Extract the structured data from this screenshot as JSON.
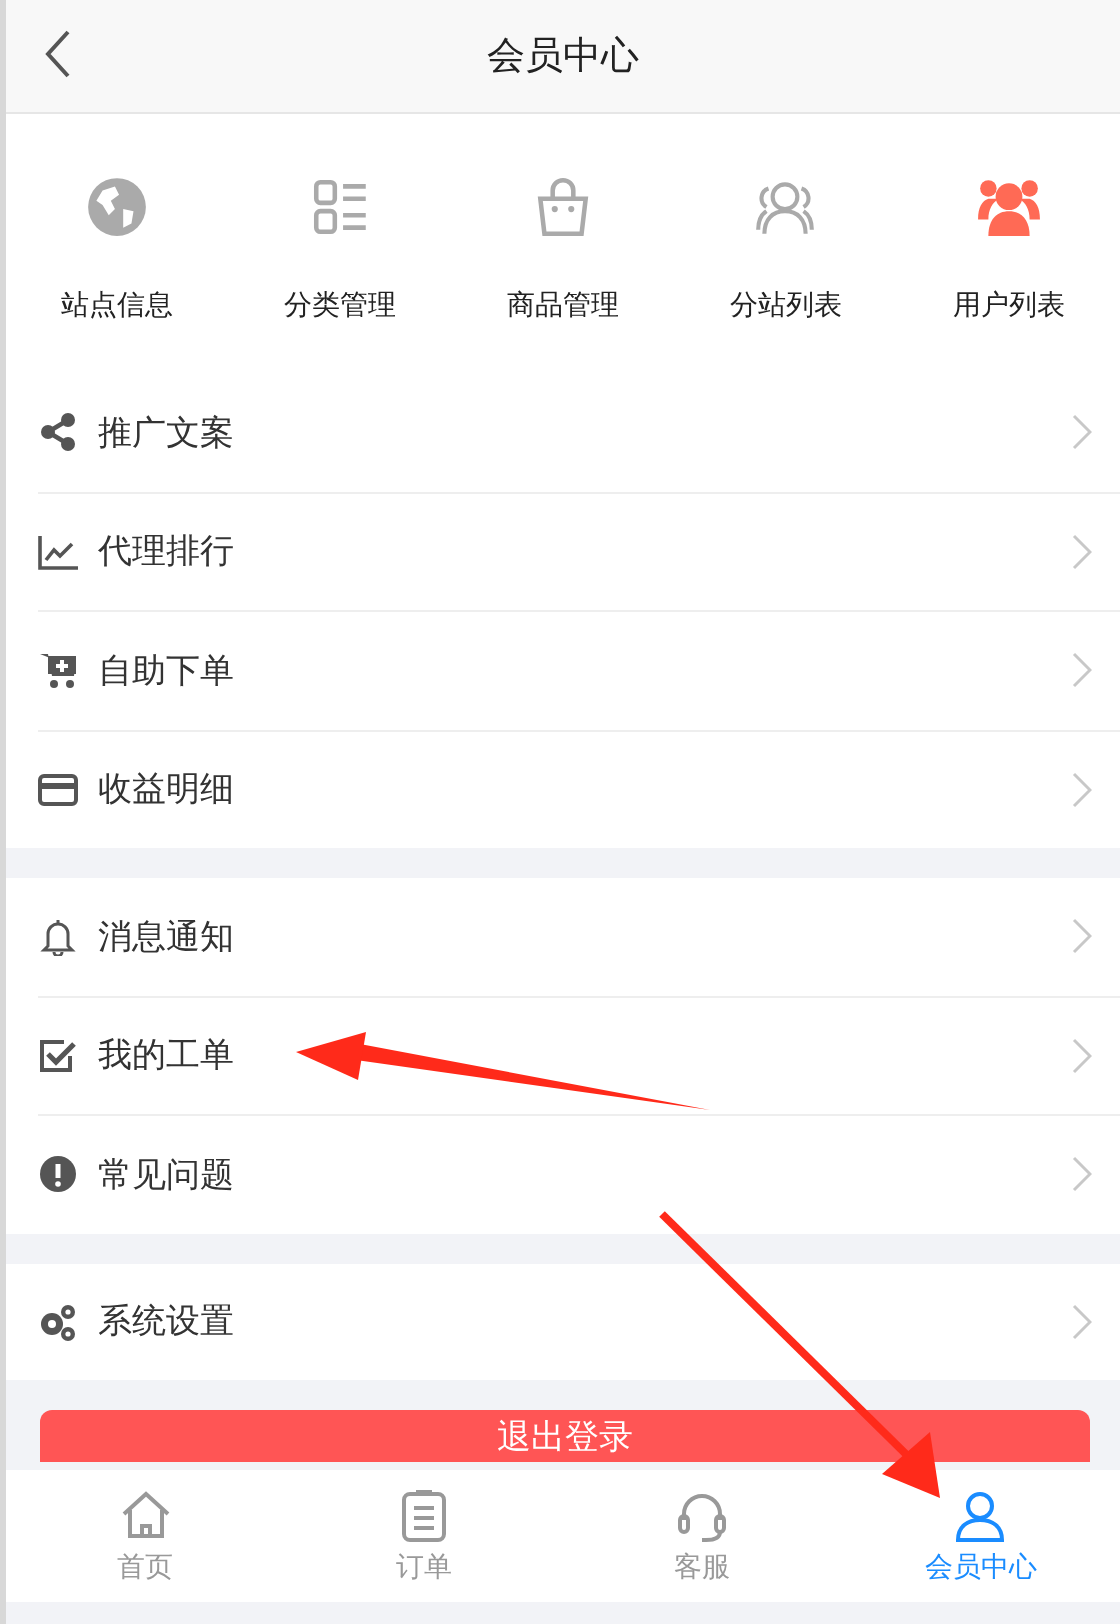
{
  "header": {
    "title": "会员中心"
  },
  "shortcuts": [
    {
      "label": "站点信息",
      "color": "#aaaaaa"
    },
    {
      "label": "分类管理",
      "color": "#aaaaaa"
    },
    {
      "label": "商品管理",
      "color": "#aaaaaa"
    },
    {
      "label": "分站列表",
      "color": "#aaaaaa"
    },
    {
      "label": "用户列表",
      "color": "#ff6a55"
    }
  ],
  "menu_groups": [
    {
      "items": [
        {
          "label": "推广文案"
        },
        {
          "label": "代理排行"
        },
        {
          "label": "自助下单"
        },
        {
          "label": "收益明细"
        }
      ]
    },
    {
      "items": [
        {
          "label": "消息通知"
        },
        {
          "label": "我的工单"
        },
        {
          "label": "常见问题"
        }
      ]
    },
    {
      "items": [
        {
          "label": "系统设置"
        }
      ]
    }
  ],
  "logout_button": "退出登录",
  "tab_bar": [
    {
      "label": "首页",
      "selected": false
    },
    {
      "label": "订单",
      "selected": false
    },
    {
      "label": "客服",
      "selected": false
    },
    {
      "label": "会员中心",
      "selected": true
    }
  ]
}
